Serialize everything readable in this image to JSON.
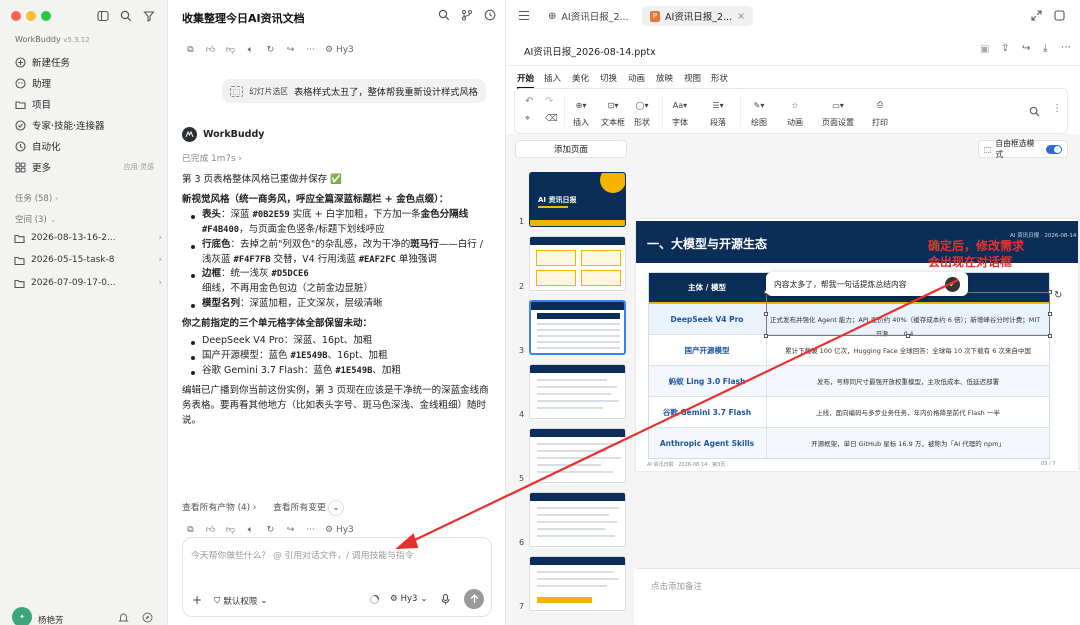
{
  "app": {
    "name": "WorkBuddy",
    "version": "v5.3.12"
  },
  "sidebar": {
    "items": [
      {
        "label": "新建任务",
        "icon": "new-task-icon"
      },
      {
        "label": "助理",
        "icon": "assistant-icon"
      },
      {
        "label": "项目",
        "icon": "project-icon"
      },
      {
        "label": "专家·技能·连接器",
        "icon": "expert-icon"
      },
      {
        "label": "自动化",
        "icon": "automation-icon"
      },
      {
        "label": "更多",
        "icon": "more-icon",
        "extra": "应用·灵感"
      }
    ],
    "tasks_header": "任务 (58)",
    "spaces_header": "空间 (3)",
    "spaces": [
      "2026-08-13-16-2...",
      "2026-05-15-task-8",
      "2026-07-09-17-0..."
    ],
    "user": {
      "name": "杨艳芳",
      "avatar": "avatar"
    }
  },
  "chat": {
    "title": "收集整理今日AI资讯文档",
    "model": "Hy3",
    "user_message_tag": "幻灯片选区",
    "user_message": "表格样式太丑了，整体帮我重新设计样式风格",
    "assistant_name": "WorkBuddy",
    "status": "已完成 1m7s",
    "p1": "第 3 页表格整体风格已重做并保存 ✅",
    "style_heading": "新视觉风格（统一商务风，呼应全篇深蓝标题栏 + 金色点缀）：",
    "b1": {
      "k": "表头",
      "t1": "：深蓝 ",
      "c1": "#0B2E59",
      "t2": " 实底 + 白字加粗，下方加一条",
      "s": "金色分隔线",
      "c2": "#F4B400",
      "t3": "，与页面金色竖条/标题下划线呼应"
    },
    "b2": {
      "k": "行底色",
      "t1": "：去掉之前\"列双色\"的杂乱感，改为干净的",
      "s": "斑马行",
      "t2": "——白行 / 浅灰蓝 ",
      "c1": "#F4F7FB",
      "t3": " 交替，V4 行用浅蓝 ",
      "c2": "#EAF2FC",
      "t4": " 单独强调"
    },
    "b3": {
      "k": "边框",
      "t1": "：统一浅灰 ",
      "c1": "#D5DCE6",
      "t2": "细线，不再用金色包边（之前金边显脏）"
    },
    "b4": {
      "k": "模型名列",
      "t1": "：深蓝加粗，正文深灰，层级清晰"
    },
    "kept_heading": "你之前指定的三个单元格字体全部保留未动：",
    "k1": {
      "t": "DeepSeek V4 Pro：深蓝、16pt、加粗"
    },
    "k2": {
      "t1": "国产开源模型：蓝色 ",
      "c": "#1E549B",
      "t2": "、16pt、加粗"
    },
    "k3": {
      "t1": "谷歌 Gemini 3.7 Flash：蓝色 ",
      "c": "#1E549B",
      "t2": "、加粗"
    },
    "p2": "编辑已广播到你当前这份实例，第 3 页现在应该是干净统一的深蓝金线商务表格。要再看其他地方（比如表头字号、斑马色深浅、金线粗细）随时说。",
    "view_outputs": "查看所有产物 (4)",
    "view_changes": "查看所有变更",
    "input_placeholder": "今天帮你做些什么？ @ 引用对话文件，/ 调用技能与指令",
    "permission": "默认权限"
  },
  "doc": {
    "tab1": "AI资讯日报_2...",
    "tab2": "AI资讯日报_2...",
    "filename": "AI资讯日报_2026-08-14.pptx",
    "ribbon_tabs": [
      "开始",
      "插入",
      "美化",
      "切换",
      "动画",
      "放映",
      "视图",
      "形状"
    ],
    "ribbon_buttons": [
      "插入",
      "文本框",
      "形状",
      "字体",
      "段落",
      "绘图",
      "动画",
      "页面设置",
      "打印"
    ],
    "add_page": "添加页面",
    "free_select": "自由框选模式",
    "thumb_numbers": [
      "1",
      "2",
      "3",
      "4",
      "5",
      "6",
      "7"
    ],
    "thumb1_title": "AI 资讯日报",
    "slide_title": "一、大模型与开源生态",
    "slide_header_right": "AI 资讯日报 · 2026-08-14",
    "table_header": [
      "主体 / 模型",
      ""
    ],
    "rows": [
      {
        "name": "DeepSeek V4 Pro",
        "desc": "正式发布并强化 Agent 能力；API 涨价约 40%（缓存成本约 6 倍）；新增峰谷分时计费；MIT"
      },
      {
        "name": "国产开源模型",
        "desc": "累计下载破 100 亿次，Hugging Face 全球回答：全球每 10 次下载有 6 次来自中国"
      },
      {
        "name": "蚂蚁 Ling 3.0 Flash",
        "desc": "发布，号称同尺寸最强开放权重模型，主攻低成本、低延迟部署"
      },
      {
        "name": "谷歌 Gemini 3.7 Flash",
        "desc": "上线，面向编码与多步业务任务，年内价格降至前代 Flash 一半"
      },
      {
        "name": "Anthropic Agent Skills",
        "desc": "开源框架，单日 GitHub 星标 16.9 万，被称为「AI 代理的 npm」"
      }
    ],
    "row0_trail": "开源 …… 0.4",
    "slide_footer_left": "AI 资讯日报 · 2026-08-14 · 第3页",
    "slide_footer_right": "03 / 7",
    "popup": "内容太多了，帮我一句话提炼总结内容",
    "annotation": "确定后，修改需求\n会出现在对话框",
    "notes": "点击添加备注",
    "colors": {
      "navy": "#0B2E59",
      "gold": "#F4B400",
      "blue": "#1E549B",
      "annot": "#e5322d"
    }
  }
}
